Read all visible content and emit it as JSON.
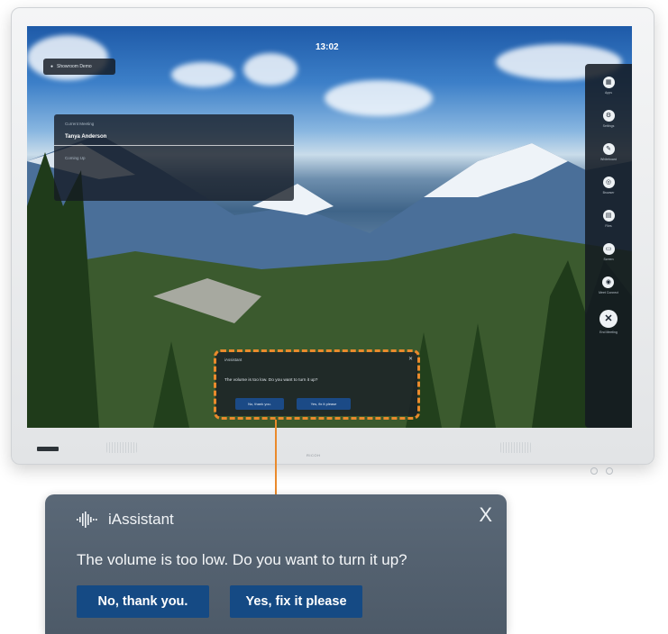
{
  "screen": {
    "time": "13:02",
    "location_pill": "Showroom Demo",
    "meeting": {
      "label": "Current Meeting",
      "organizer": "Tanya Anderson",
      "more": "Coming Up"
    },
    "sidebar": {
      "items": [
        {
          "icon": "apps-icon",
          "glyph": "▦",
          "label": "Apps"
        },
        {
          "icon": "settings-icon",
          "glyph": "⚙",
          "label": "Settings"
        },
        {
          "icon": "whiteboard-icon",
          "glyph": "✎",
          "label": "Whiteboard"
        },
        {
          "icon": "browser-icon",
          "glyph": "◎",
          "label": "Browser"
        },
        {
          "icon": "file-icon",
          "glyph": "▤",
          "label": "Files"
        },
        {
          "icon": "screen-share-icon",
          "glyph": "▭",
          "label": "Screen"
        },
        {
          "icon": "meeting-icon",
          "glyph": "◉",
          "label": "Meet Connect"
        },
        {
          "icon": "end-session-icon",
          "glyph": "✕",
          "label": "End Meeting"
        }
      ]
    },
    "mini_popup": {
      "title": "iAssistant",
      "question": "The volume is too low. Do you want to turn it up?",
      "no_label": "No, thank you.",
      "yes_label": "Yes, fix it please"
    }
  },
  "bezel": {
    "brand": "RICOH"
  },
  "callout": {
    "title": "iAssistant",
    "close_glyph": "X",
    "question": "The volume is too low. Do you want to turn it up?",
    "no_button": "No, thank you.",
    "yes_button": "Yes, fix it please"
  },
  "colors": {
    "highlight": "#ea8a2c",
    "callout_bg": "#56636f",
    "button_bg": "#154a84"
  }
}
